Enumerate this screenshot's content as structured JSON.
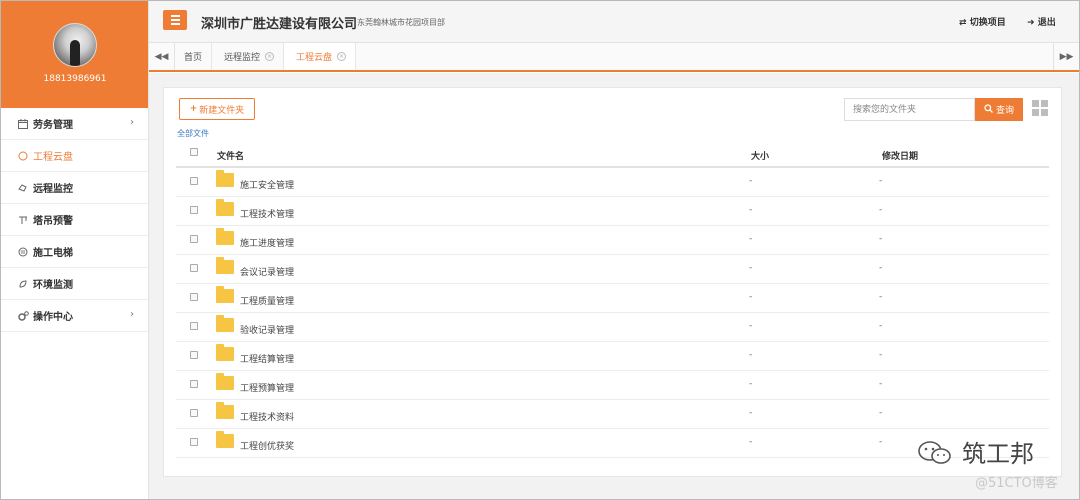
{
  "user": {
    "phone": "18813986961"
  },
  "sidebar": {
    "items": [
      {
        "label": "劳务管理",
        "icon": "calendar-icon",
        "has_arrow": true
      },
      {
        "label": "工程云盘",
        "icon": "cloud-icon",
        "active": true
      },
      {
        "label": "远程监控",
        "icon": "camera-icon"
      },
      {
        "label": "塔吊预警",
        "icon": "crane-icon"
      },
      {
        "label": "施工电梯",
        "icon": "elevator-icon"
      },
      {
        "label": "环境监测",
        "icon": "environment-icon"
      },
      {
        "label": "操作中心",
        "icon": "gears-icon",
        "has_arrow": true
      }
    ]
  },
  "header": {
    "company": "深圳市广胜达建设有限公司",
    "project": "东莞翰林城市花园项目部",
    "switch_label": "切换项目",
    "logout_label": "退出"
  },
  "tabs": [
    {
      "label": "首页"
    },
    {
      "label": "远程监控",
      "closable": true
    },
    {
      "label": "工程云盘",
      "closable": true,
      "active": true
    }
  ],
  "toolbar": {
    "new_folder_label": "新建文件夹",
    "search_placeholder": "搜索您的文件夹",
    "search_button": "查询"
  },
  "breadcrumb": "全部文件",
  "table": {
    "headers": {
      "name": "文件名",
      "size": "大小",
      "modified": "修改日期"
    },
    "rows": [
      {
        "name": "施工安全管理",
        "size": "-",
        "modified": "-"
      },
      {
        "name": "工程技术管理",
        "size": "-",
        "modified": "-"
      },
      {
        "name": "施工进度管理",
        "size": "-",
        "modified": "-"
      },
      {
        "name": "会议记录管理",
        "size": "-",
        "modified": "-"
      },
      {
        "name": "工程质量管理",
        "size": "-",
        "modified": "-"
      },
      {
        "name": "验收记录管理",
        "size": "-",
        "modified": "-"
      },
      {
        "name": "工程结算管理",
        "size": "-",
        "modified": "-"
      },
      {
        "name": "工程预算管理",
        "size": "-",
        "modified": "-"
      },
      {
        "name": "工程技术资料",
        "size": "-",
        "modified": "-"
      },
      {
        "name": "工程创优获奖",
        "size": "-",
        "modified": "-"
      }
    ]
  },
  "watermark": {
    "brand": "筑工邦",
    "site": "@51CTO博客"
  },
  "colors": {
    "accent": "#ef7c35",
    "folder": "#f6c544",
    "link": "#3a7bc8"
  }
}
